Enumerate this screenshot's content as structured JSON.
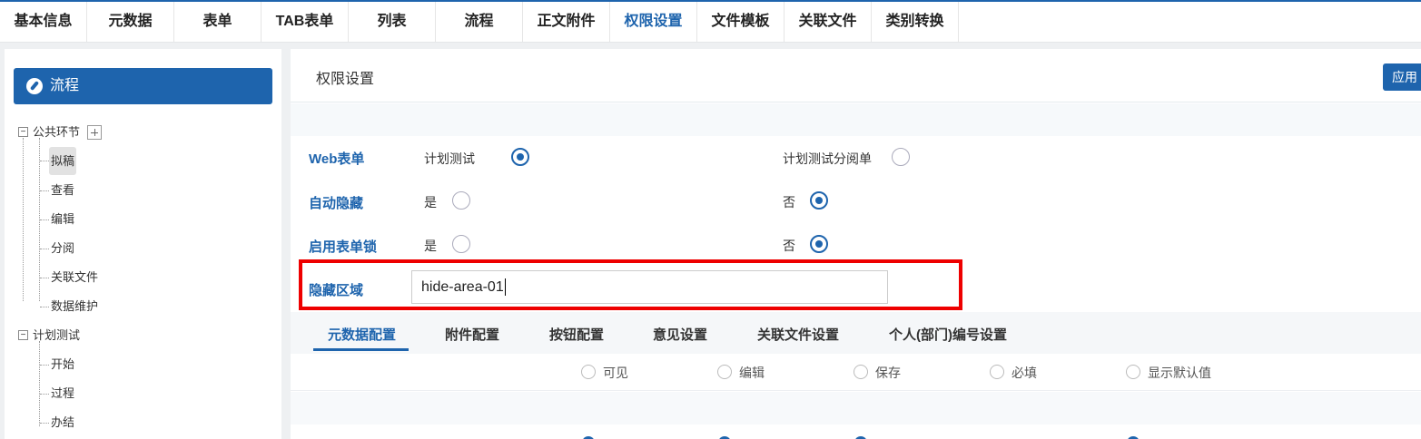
{
  "top_tabs": [
    {
      "label": "基本信息"
    },
    {
      "label": "元数据"
    },
    {
      "label": "表单"
    },
    {
      "label": "TAB表单"
    },
    {
      "label": "列表"
    },
    {
      "label": "流程"
    },
    {
      "label": "正文附件"
    },
    {
      "label": "权限设置",
      "active": true
    },
    {
      "label": "文件模板"
    },
    {
      "label": "关联文件"
    },
    {
      "label": "类别转换"
    }
  ],
  "sidebar": {
    "flow_button": "流程",
    "tree": {
      "group1": {
        "label": "公共环节",
        "items": [
          "拟稿",
          "查看",
          "编辑",
          "分阅",
          "关联文件",
          "数据维护"
        ]
      },
      "group2": {
        "label": "计划测试",
        "items": [
          "开始",
          "过程",
          "办结"
        ]
      }
    }
  },
  "main": {
    "title": "权限设置",
    "apply_button": "应用",
    "rows": {
      "web_form": {
        "label": "Web表单",
        "opt1": "计划测试",
        "opt2": "计划测试分阅单",
        "selected": "计划测试"
      },
      "auto_hide": {
        "label": "自动隐藏",
        "opt1": "是",
        "opt2": "否",
        "selected": "否"
      },
      "form_lock": {
        "label": "启用表单锁",
        "opt1": "是",
        "opt2": "否",
        "selected": "否"
      },
      "hide_area": {
        "label": "隐藏区域",
        "value": "hide-area-01"
      }
    },
    "sub_tabs": [
      "元数据配置",
      "附件配置",
      "按钮配置",
      "意见设置",
      "关联文件设置",
      "个人(部门)编号设置"
    ],
    "active_sub_tab": "元数据配置",
    "columns": [
      "可见",
      "编辑",
      "保存",
      "必填",
      "显示默认值"
    ]
  },
  "colors": {
    "accent": "#1e64ad",
    "highlight": "#ee0000"
  }
}
